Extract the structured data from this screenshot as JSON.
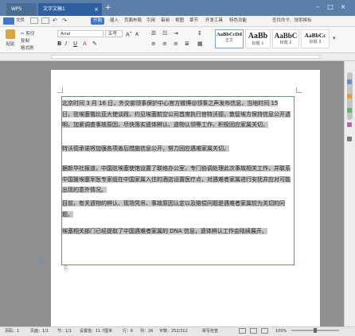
{
  "tabs": {
    "app": "WPS",
    "document": "文字文稿1"
  },
  "window": {
    "minimize": "–",
    "maximize": "□",
    "close": "×"
  },
  "menu": [
    "文件",
    "开始",
    "插入",
    "页面布局",
    "引用",
    "审阅",
    "视图",
    "章节",
    "开发工具",
    "特色功能"
  ],
  "search_hint": "查找命令、搜索模板",
  "toolbar": {
    "paste": "粘贴",
    "cut": "剪切",
    "copy": "复制",
    "format_painter": "格式刷",
    "font": "Arial",
    "size": "五号"
  },
  "styles": [
    {
      "sample": "AaBbCcDd",
      "name": "正文"
    },
    {
      "sample": "AaBb",
      "name": "标题 1"
    },
    {
      "sample": "AaBbC",
      "name": "标题 2"
    },
    {
      "sample": "AaBbCc",
      "name": "标题 3"
    }
  ],
  "document": {
    "paragraphs": [
      "北京时间 3 月 16 日，外交部领事保护中心官方微博@领事之声发布信息，当地时间 15 日，驻埃塞俄比亚大使谈践，约见埃塞航空公司首席执行官特沃德，敦促埃方保持信息公开透明，加紧调查事故原因，尽快落实遗体辨认、遗物认领等工作，积极回应家属关切。",
      "特沃德承诺将加强各项善后措施信息公开，努力回应遇难家属关切。",
      "据新华社报道，中国驻埃塞使馆设置了联络办公室，专门协调处理此次事故相关工作，并联系中国援埃塞军医专家组在中国家属入住的酒店设置医疗点，对遇难者家属进行安抚并应对可能出现的意外情况。",
      "目前，有关遗物的辨认、现场凭吊、事故原因认定以及赔偿问题是遇难者家属较为关切的问题。",
      "埃塞相关部门已经提取了中国遇难者家属的 DNA 信息，遗体辨认工作会陆续展开。"
    ]
  },
  "status": {
    "page": "页码：1",
    "pages": "页面：1/1",
    "section": "节：1/1",
    "setting": "设置值：11.7厘米",
    "row": "行：6",
    "col": "列：26",
    "words": "字数：252/312",
    "spell": "拼写检查",
    "zoom": "100%"
  },
  "colors": {
    "title_bg": "#5b7fa8",
    "accent": "#3f76c6",
    "selection_border": "#e05a5a",
    "highlight": "#c8c8c8"
  }
}
